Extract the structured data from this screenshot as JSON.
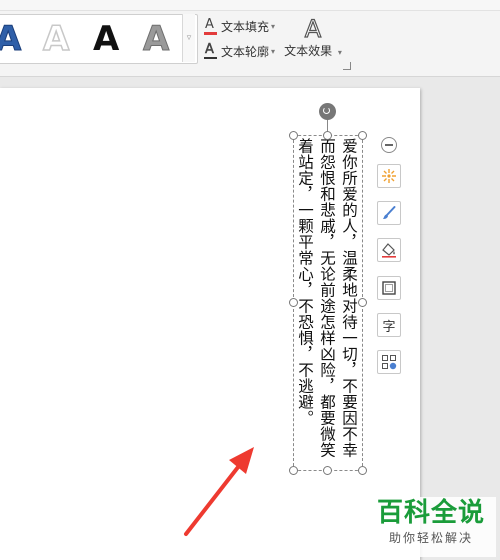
{
  "ribbon": {
    "style_gallery": [
      "A",
      "A",
      "A",
      "A"
    ],
    "text_fill_label": "文本填充",
    "text_outline_label": "文本轮廓",
    "text_effect_label": "文本效果",
    "text_effect_glyph": "A",
    "fill_glyph": "A",
    "outline_glyph": "A",
    "caret": "▾",
    "gallery_more": "▿"
  },
  "document": {
    "textbox_text": "爱你所爱的人，温柔地对待一切，不要因不幸而怨恨和悲戚，无论前途怎样凶险，都要微笑着站定，一颗平常心，不恐惧，不逃避。"
  },
  "float_toolbar": {
    "buttons": [
      "shape-effect",
      "format-painter",
      "fill",
      "outline",
      "text-wrap",
      "layout-options"
    ],
    "text_wrap_glyph": "字"
  },
  "watermark": {
    "title": "百科全说",
    "subtitle": "助你轻松解决"
  },
  "colors": {
    "accent_red": "#e23b3b",
    "watermark_green": "#1a9c3a"
  }
}
